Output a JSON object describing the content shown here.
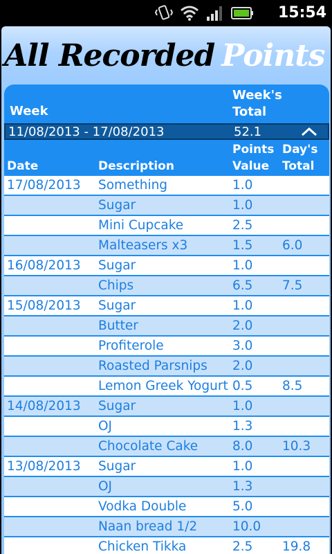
{
  "status_bar": {
    "time": "15:54",
    "icons": [
      "vibrate-icon",
      "wifi-icon",
      "signal-icon",
      "battery-icon"
    ]
  },
  "title": {
    "part1": "All Recorded",
    "part2": "Points"
  },
  "table": {
    "week_header": "Week",
    "weeks_total_header": "Week's Total",
    "week_range": "11/08/2013 - 17/08/2013",
    "week_total": "52.1",
    "columns": {
      "date": "Date",
      "description": "Description",
      "points": "Points Value",
      "day_total": "Day's Total"
    },
    "rows": [
      {
        "date": "17/08/2013",
        "desc": "Something",
        "points": "1.0",
        "day_total": ""
      },
      {
        "date": "",
        "desc": "Sugar",
        "points": "1.0",
        "day_total": ""
      },
      {
        "date": "",
        "desc": "Mini Cupcake",
        "points": "2.5",
        "day_total": ""
      },
      {
        "date": "",
        "desc": "Malteasers x3",
        "points": "1.5",
        "day_total": "6.0"
      },
      {
        "date": "16/08/2013",
        "desc": "Sugar",
        "points": "1.0",
        "day_total": ""
      },
      {
        "date": "",
        "desc": "Chips",
        "points": "6.5",
        "day_total": "7.5"
      },
      {
        "date": "15/08/2013",
        "desc": "Sugar",
        "points": "1.0",
        "day_total": ""
      },
      {
        "date": "",
        "desc": "Butter",
        "points": "2.0",
        "day_total": ""
      },
      {
        "date": "",
        "desc": "Profiterole",
        "points": "3.0",
        "day_total": ""
      },
      {
        "date": "",
        "desc": "Roasted Parsnips",
        "points": "2.0",
        "day_total": ""
      },
      {
        "date": "",
        "desc": "Lemon Greek Yogurt",
        "points": "0.5",
        "day_total": "8.5"
      },
      {
        "date": "14/08/2013",
        "desc": "Sugar",
        "points": "1.0",
        "day_total": ""
      },
      {
        "date": "",
        "desc": "OJ",
        "points": "1.3",
        "day_total": ""
      },
      {
        "date": "",
        "desc": "Chocolate Cake",
        "points": "8.0",
        "day_total": "10.3"
      },
      {
        "date": "13/08/2013",
        "desc": "Sugar",
        "points": "1.0",
        "day_total": ""
      },
      {
        "date": "",
        "desc": "OJ",
        "points": "1.3",
        "day_total": ""
      },
      {
        "date": "",
        "desc": "Vodka Double",
        "points": "5.0",
        "day_total": ""
      },
      {
        "date": "",
        "desc": "Naan bread 1/2",
        "points": "10.0",
        "day_total": ""
      },
      {
        "date": "",
        "desc": "Chicken Tikka",
        "points": "2.5",
        "day_total": "19.8"
      }
    ]
  },
  "colors": {
    "header_blue": "#1d8df2",
    "week_bar": "#0f5a9e",
    "row_text": "#1d7fe0",
    "row_alt": "#c8e1fb"
  }
}
